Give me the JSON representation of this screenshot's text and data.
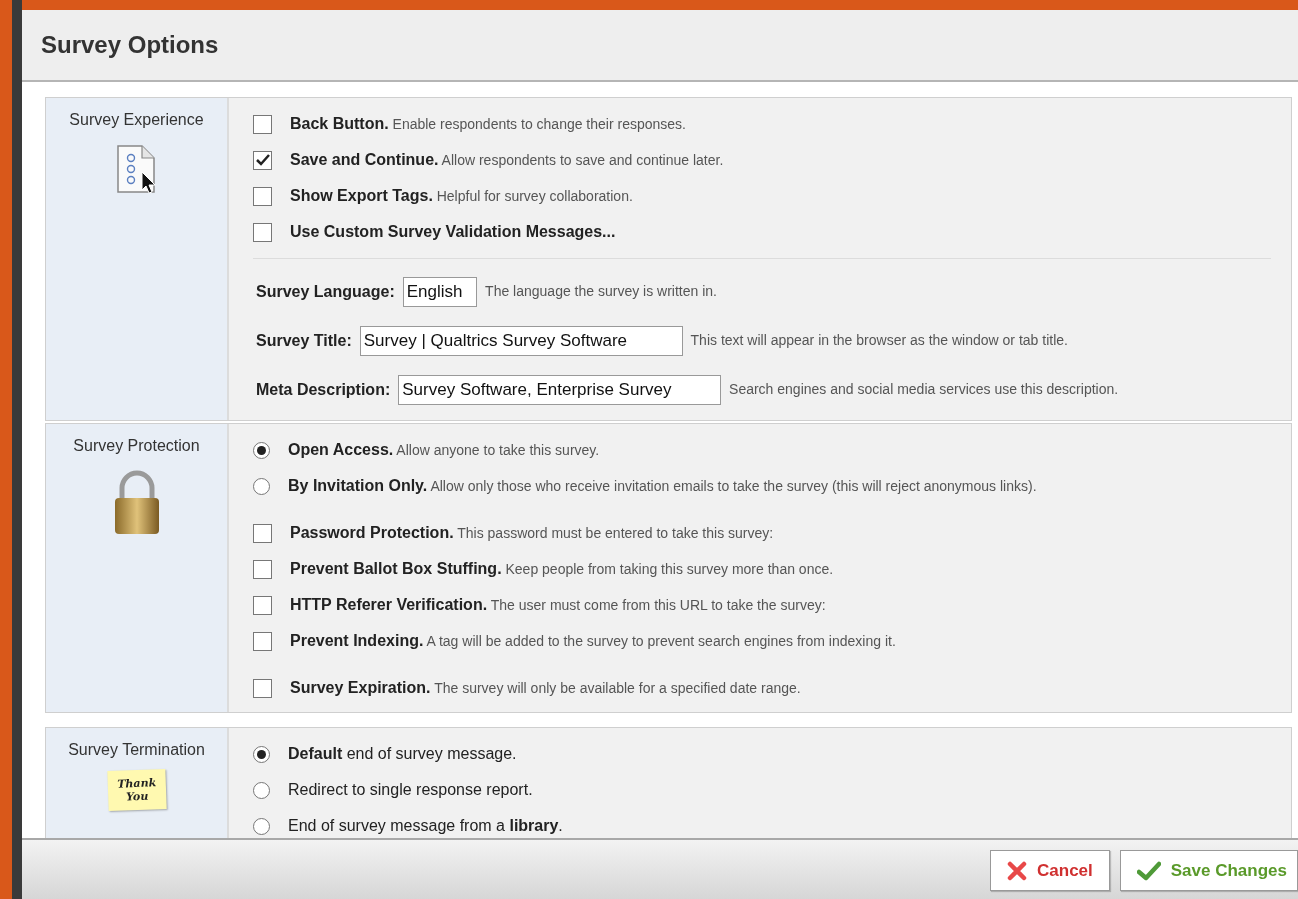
{
  "dialog": {
    "title": "Survey Options"
  },
  "sections": [
    {
      "title": "Survey Experience",
      "options": [
        {
          "kind": "checkbox",
          "label": "Back Button.",
          "description": "Enable respondents to change their responses.",
          "checked": false
        },
        {
          "kind": "checkbox",
          "label": "Save and Continue.",
          "description": "Allow respondents to save and continue later.",
          "checked": true
        },
        {
          "kind": "checkbox",
          "label": "Show Export Tags.",
          "description": "Helpful for survey collaboration.",
          "checked": false
        },
        {
          "kind": "checkbox",
          "label": "Use Custom Survey Validation Messages...",
          "checked": false
        }
      ],
      "fields": [
        {
          "label": "Survey Language:",
          "value": "English",
          "description": "The language the survey is written in."
        },
        {
          "label": "Survey Title:",
          "value": "Survey | Qualtrics Survey Software",
          "description": "This text will appear in the browser as the window or tab title."
        },
        {
          "label": "Meta Description:",
          "value": "Survey Software, Enterprise Survey",
          "description": "Search engines and social media services use this description."
        }
      ]
    },
    {
      "title": "Survey Protection",
      "options": [
        {
          "kind": "radio",
          "label": "Open Access.",
          "description": "Allow anyone to take this survey.",
          "selected": true
        },
        {
          "kind": "radio",
          "label": "By Invitation Only.",
          "description": "Allow only those who receive invitation emails to take the survey (this will reject anonymous links).",
          "selected": false
        },
        {
          "kind": "checkbox",
          "label": "Password Protection.",
          "description": "This password must be entered to take this survey:",
          "checked": false
        },
        {
          "kind": "checkbox",
          "label": "Prevent Ballot Box Stuffing.",
          "description": "Keep people from taking this survey more than once.",
          "checked": false
        },
        {
          "kind": "checkbox",
          "label": "HTTP Referer Verification.",
          "description": "The user must come from this URL to take the survey:",
          "checked": false
        },
        {
          "kind": "checkbox",
          "label": "Prevent Indexing.",
          "description": "A tag will be added to the survey to prevent search engines from indexing it.",
          "checked": false
        },
        {
          "kind": "checkbox",
          "label": "Survey Expiration.",
          "description": "The survey will only be available for a specified date range.",
          "checked": false
        }
      ]
    },
    {
      "title": "Survey Termination",
      "note_text": "Thank You",
      "options": [
        {
          "kind": "radio",
          "text": "**Default** end of survey message.",
          "selected": true
        },
        {
          "kind": "radio",
          "text": "Redirect to single response report.",
          "selected": false
        },
        {
          "kind": "radio",
          "text": "End of survey message from a **library**.",
          "selected": false
        }
      ]
    }
  ],
  "buttons": [
    {
      "kind": "cancel",
      "label": "Cancel"
    },
    {
      "kind": "save",
      "label": "Save Changes"
    }
  ]
}
